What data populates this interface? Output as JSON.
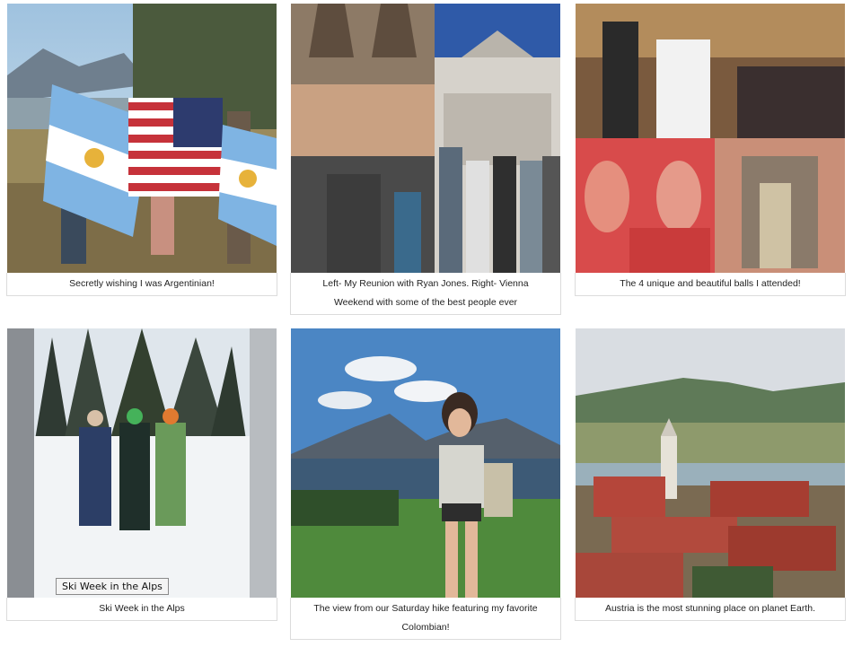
{
  "gallery": {
    "items": [
      {
        "caption": "Secretly wishing I was Argentinian!",
        "alt": "friends-with-flags-photo"
      },
      {
        "caption": "Left- My Reunion with Ryan Jones. Right- Vienna Weekend with some of the best people ever",
        "alt": "prague-vienna-collage-photo"
      },
      {
        "caption": "The 4 unique and beautiful balls I attended!",
        "alt": "balls-collage-photo"
      },
      {
        "caption": "Ski Week in the Alps",
        "alt": "ski-group-photo",
        "tooltip": "Ski Week in the Alps"
      },
      {
        "caption": "The view from our Saturday hike featuring my favorite Colombian!",
        "alt": "lake-hike-photo"
      },
      {
        "caption": "Austria is the most stunning place on planet Earth.",
        "alt": "austria-village-river-photo"
      }
    ]
  }
}
